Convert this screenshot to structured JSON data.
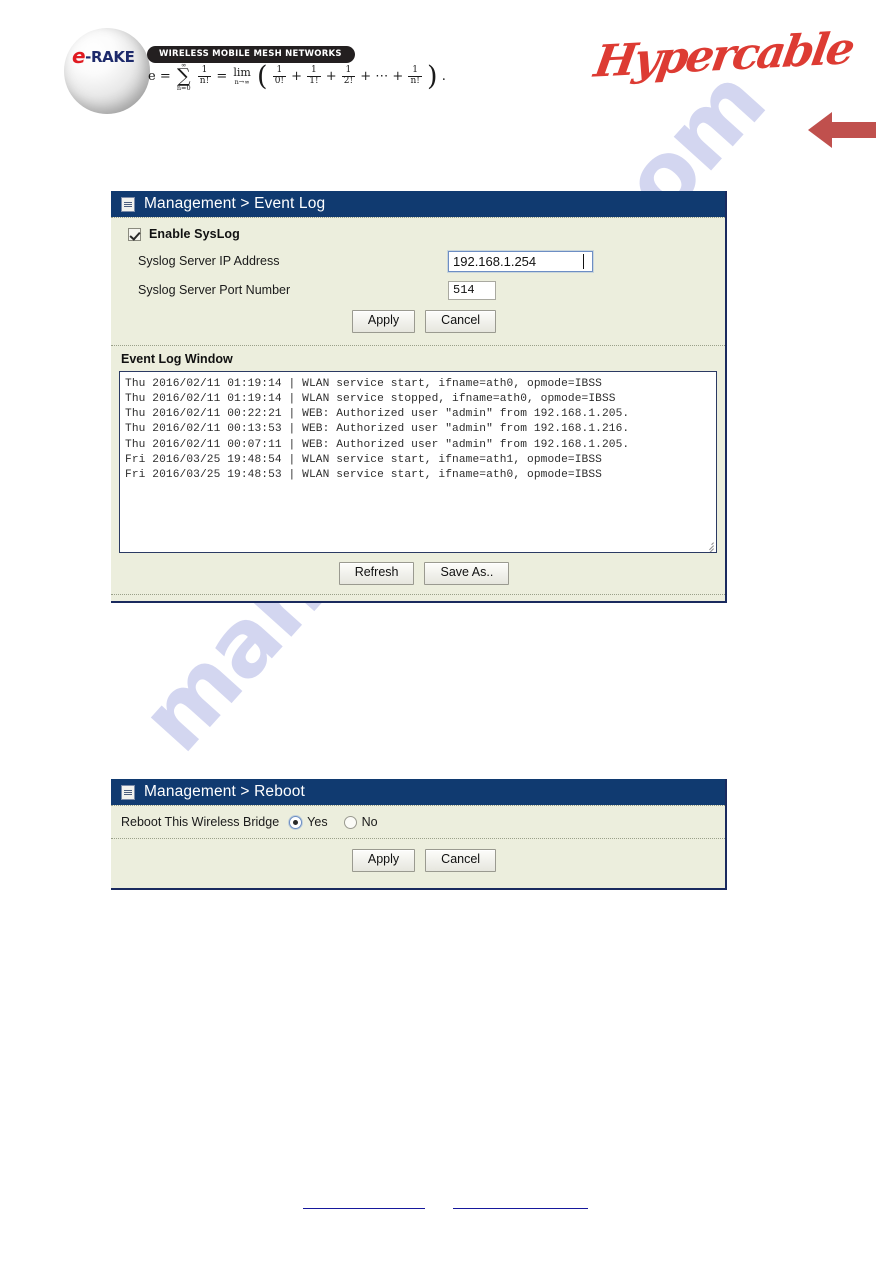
{
  "branding": {
    "erake_e": "e",
    "erake_rake": "-RAKE",
    "tagline": "WIRELESS MOBILE MESH NETWORKS",
    "hypercable": "Hypercable",
    "formula_lead": "e =",
    "formula_sum_sup": "∞",
    "formula_sum_op": "∑",
    "formula_sum_sub": "n=0",
    "formula_frac1_num": "1",
    "formula_frac1_den": "n!",
    "formula_eq2": "=",
    "formula_lim_op": "lim",
    "formula_lim_sub": "n→∞",
    "formula_paren_open": "(",
    "formula_t1_num": "1",
    "formula_t1_den": "0!",
    "formula_plus1": "+",
    "formula_t2_num": "1",
    "formula_t2_den": "1!",
    "formula_plus2": "+",
    "formula_t3_num": "1",
    "formula_t3_den": "2!",
    "formula_plus3": "+ ⋯ +",
    "formula_t4_num": "1",
    "formula_t4_den": "n!",
    "formula_paren_close": ")",
    "formula_tail": "."
  },
  "watermark": {
    "text": "manualshive.com"
  },
  "event_log_panel": {
    "title": "Management > Event Log",
    "icon": "document-lines-icon",
    "enable_syslog_label": "Enable SysLog",
    "enable_syslog_checked": true,
    "ip_label": "Syslog Server IP Address",
    "ip_value": "192.168.1.254",
    "port_label": "Syslog Server Port Number",
    "port_value": "514",
    "apply_label": "Apply",
    "cancel_label": "Cancel",
    "log_window_title": "Event Log Window",
    "log_lines": [
      "Thu 2016/02/11 01:19:14 | WLAN service start, ifname=ath0, opmode=IBSS",
      "Thu 2016/02/11 01:19:14 | WLAN service stopped, ifname=ath0, opmode=IBSS",
      "Thu 2016/02/11 00:22:21 | WEB: Authorized user \"admin\" from 192.168.1.205.",
      "Thu 2016/02/11 00:13:53 | WEB: Authorized user \"admin\" from 192.168.1.216.",
      "Thu 2016/02/11 00:07:11 | WEB: Authorized user \"admin\" from 192.168.1.205.",
      "Fri 2016/03/25 19:48:54 | WLAN service start, ifname=ath1, opmode=IBSS",
      "Fri 2016/03/25 19:48:53 | WLAN service start, ifname=ath0, opmode=IBSS"
    ],
    "refresh_label": "Refresh",
    "save_as_label": "Save As.."
  },
  "reboot_panel": {
    "title": "Management > Reboot",
    "icon": "document-lines-icon",
    "prompt_label": "Reboot This Wireless Bridge",
    "yes_label": "Yes",
    "no_label": "No",
    "selected": "Yes",
    "apply_label": "Apply",
    "cancel_label": "Cancel"
  },
  "footer": {
    "link_left": "",
    "link_right": ""
  },
  "colors": {
    "panel_header": "#103a70",
    "panel_body": "#eceedd",
    "panel_border": "#1a2a5e",
    "accent_red": "#dd3b33",
    "arrow_red": "#c0504d",
    "link_blue": "#16189c",
    "watermark": "#b9bde8"
  }
}
